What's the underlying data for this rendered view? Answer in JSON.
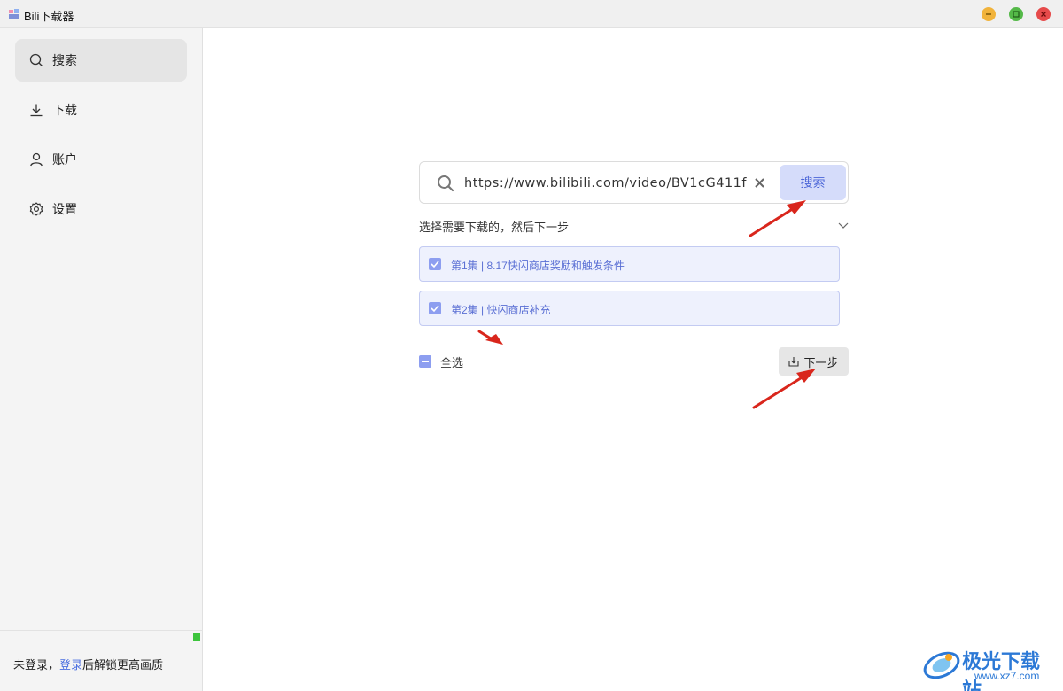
{
  "window": {
    "title": "Bili下载器",
    "controls": [
      "minimize",
      "maximize",
      "close"
    ]
  },
  "sidebar": {
    "items": [
      {
        "label": "搜索",
        "icon": "search-icon",
        "active": true
      },
      {
        "label": "下载",
        "icon": "download-icon",
        "active": false
      },
      {
        "label": "账户",
        "icon": "user-icon",
        "active": false
      },
      {
        "label": "设置",
        "icon": "gear-icon",
        "active": false
      }
    ],
    "footer": {
      "prefix": "未登录，",
      "link": "登录",
      "suffix": "后解锁更高画质"
    }
  },
  "search": {
    "value": "https://www.bilibili.com/video/BV1cG411f",
    "button_label": "搜索"
  },
  "main": {
    "instruction": "选择需要下载的，然后下一步",
    "episodes": [
      {
        "label": "第1集 | 8.17快闪商店奖励和触发条件",
        "checked": true
      },
      {
        "label": "第2集 | 快闪商店补充",
        "checked": true
      }
    ],
    "select_all_label": "全选",
    "next_label": "下一步"
  },
  "watermark": {
    "title": "极光下载站",
    "url": "www.xz7.com"
  },
  "colors": {
    "accent": "#4c66d8",
    "accent_light": "#d5dcfa",
    "checkbox": "#8d9ef0",
    "annotation_arrow": "#e0201c"
  }
}
